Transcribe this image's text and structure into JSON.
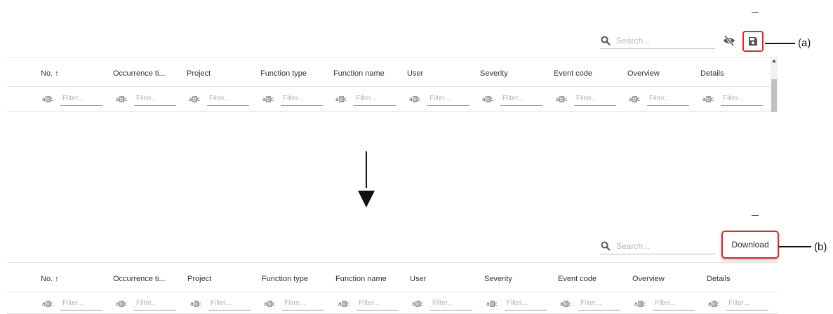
{
  "top": {
    "search": {
      "placeholder": "Search..."
    },
    "callout": "(a)",
    "columns": [
      "No. ↑",
      "Occurrence ti...",
      "Project",
      "Function type",
      "Function name",
      "User",
      "Severity",
      "Event code",
      "Overview",
      "Details"
    ],
    "filter_placeholder": "Filter...",
    "filter_type_icon": "abc"
  },
  "bottom": {
    "search": {
      "placeholder": "Search..."
    },
    "download_label": "Download",
    "callout": "(b)",
    "columns": [
      "No. ↑",
      "Occurrence ti...",
      "Project",
      "Function type",
      "Function name",
      "User",
      "Severity",
      "Event code",
      "Overview",
      "Details"
    ],
    "filter_placeholder": "Filter...",
    "filter_type_icon": "abc"
  },
  "colors": {
    "highlight": "#e0262b",
    "text": "#333333",
    "placeholder": "#b5b5b5"
  },
  "icons": [
    "minimize-icon",
    "search-icon",
    "eye-off-icon",
    "save-icon",
    "down-arrow-icon"
  ]
}
